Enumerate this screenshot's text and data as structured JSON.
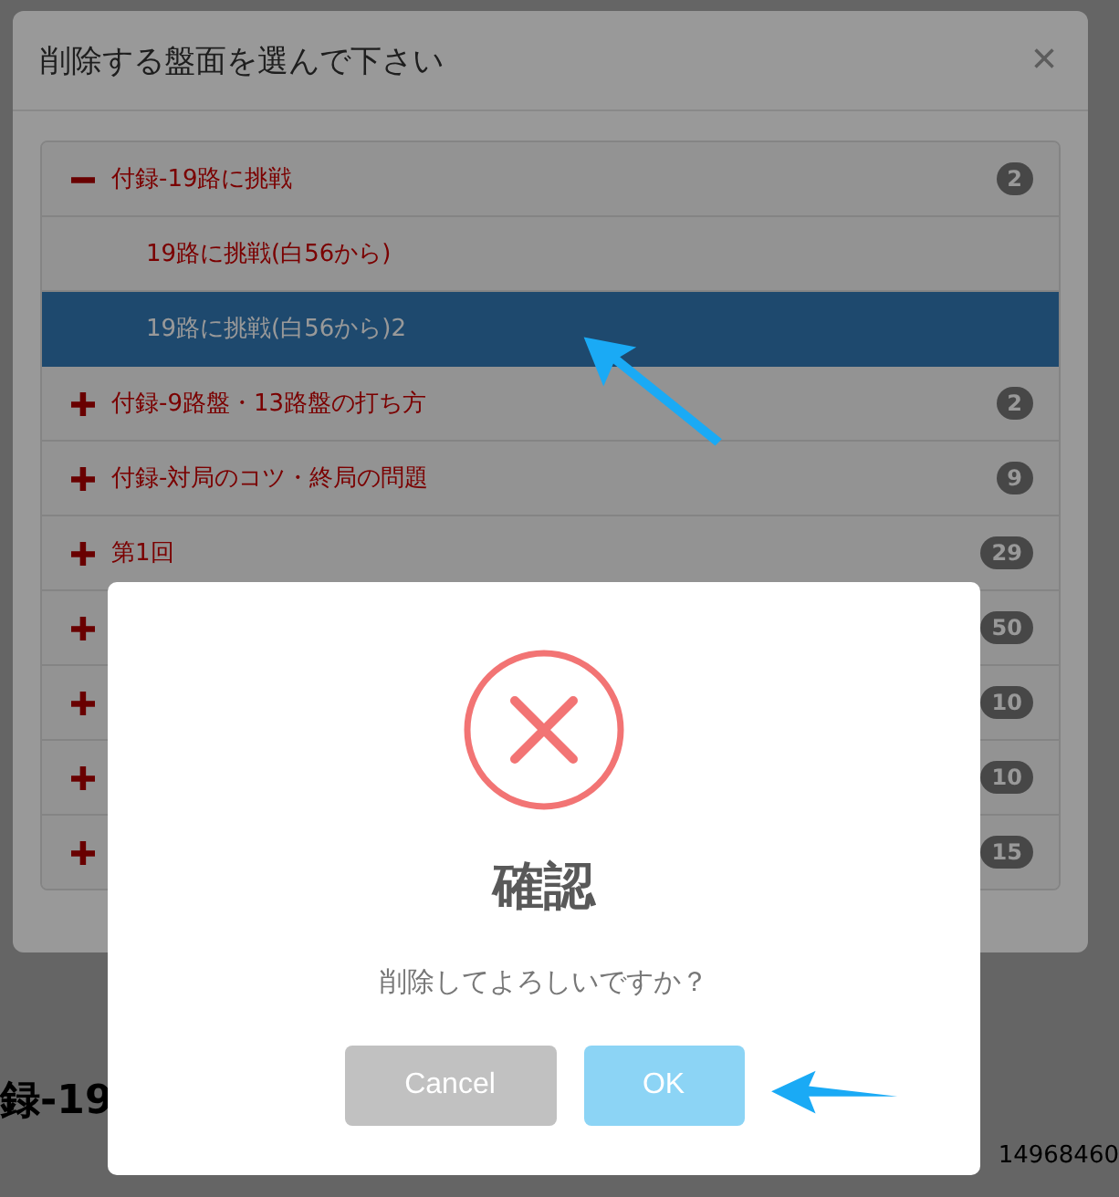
{
  "background_page": {
    "footer_title": "録-19",
    "footer_id": "14968460"
  },
  "select_modal": {
    "title": "削除する盤面を選んで下さい",
    "close": "×",
    "tree": [
      {
        "label": "付録-19路に挑戦",
        "count": "2",
        "expanded": true,
        "children": [
          {
            "label": "19路に挑戦(白56から)",
            "selected": false
          },
          {
            "label": "19路に挑戦(白56から)2",
            "selected": true
          }
        ]
      },
      {
        "label": "付録-9路盤・13路盤の打ち方",
        "count": "2",
        "expanded": false
      },
      {
        "label": "付録-対局のコツ・終局の問題",
        "count": "9",
        "expanded": false
      },
      {
        "label": "第1回",
        "count": "29",
        "expanded": false
      },
      {
        "count": "50",
        "expanded": false
      },
      {
        "count": "10",
        "expanded": false
      },
      {
        "count": "10",
        "expanded": false
      },
      {
        "count": "15",
        "expanded": false
      }
    ]
  },
  "confirm_dialog": {
    "title": "確認",
    "message": "削除してよろしいですか？",
    "buttons": [
      {
        "label": "Cancel",
        "kind": "cancel"
      },
      {
        "label": "OK",
        "kind": "confirm"
      }
    ]
  }
}
